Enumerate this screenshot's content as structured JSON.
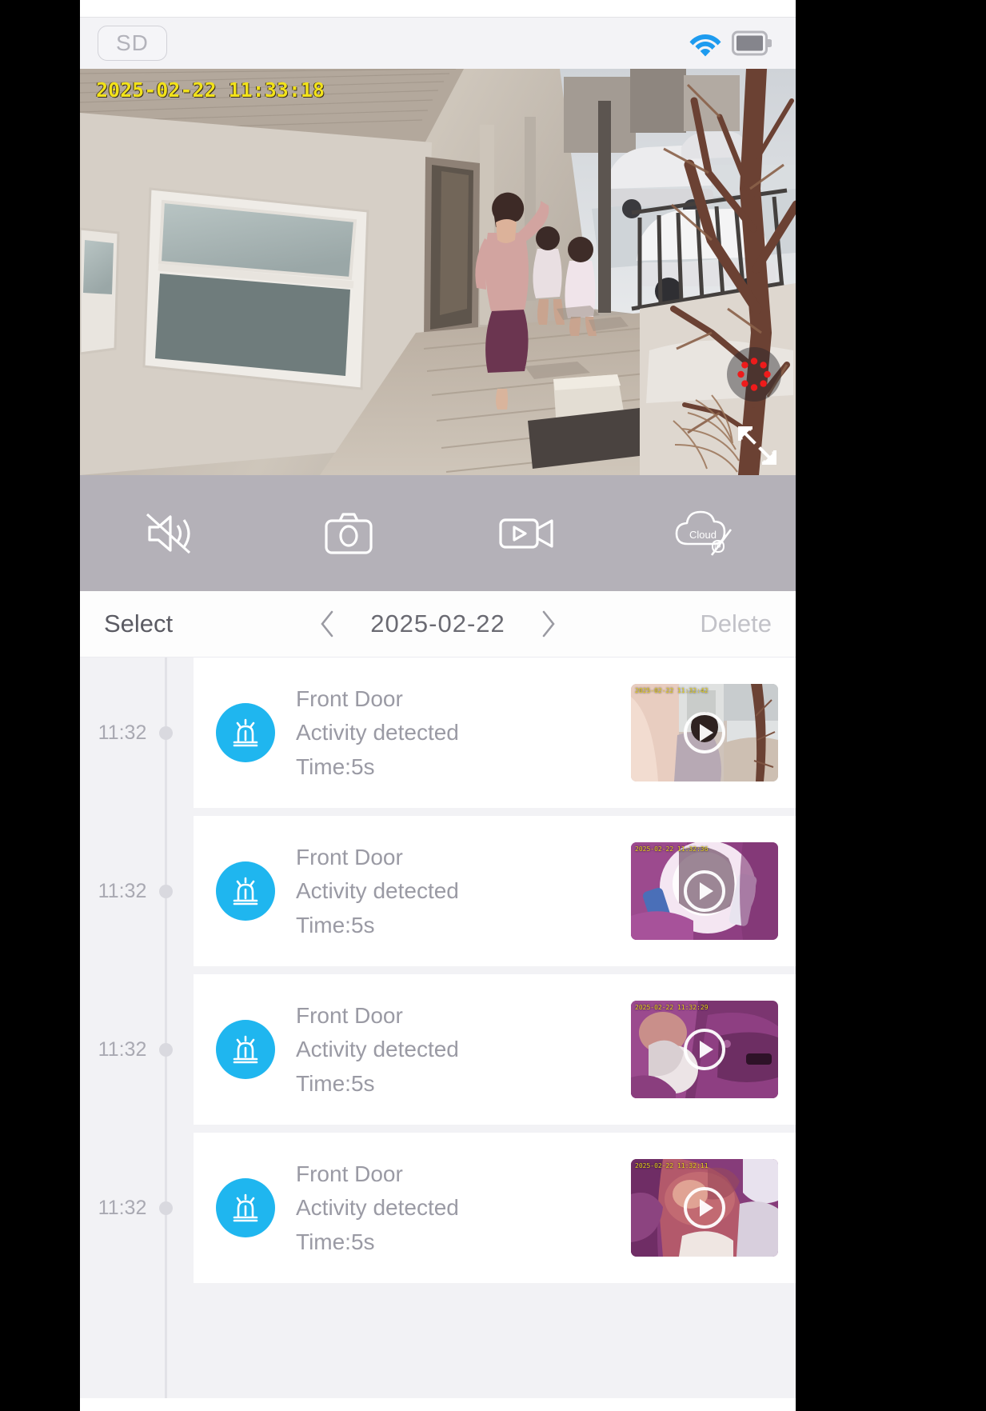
{
  "status_bar": {
    "sd_label": "SD",
    "wifi_icon": "wifi-icon",
    "battery_icon": "battery-icon",
    "wifi_color": "#1d9bef",
    "battery_color": "#8a8a90"
  },
  "video": {
    "timestamp": "2025-02-22 11:33:18",
    "timestamp_color": "#f2e21a",
    "recording_indicator": "loading-spinner-icon",
    "spinner_dot_color": "#ee1b1b",
    "fullscreen_icon": "fullscreen-expand-icon"
  },
  "controls": [
    {
      "name": "mute-button",
      "icon": "speaker-muted-icon",
      "label": "Mute"
    },
    {
      "name": "snapshot-button",
      "icon": "camera-icon",
      "label": "Snapshot"
    },
    {
      "name": "record-button",
      "icon": "video-record-icon",
      "label": "Record"
    },
    {
      "name": "cloud-button",
      "icon": "cloud-disabled-icon",
      "label": "Cloud",
      "badge": "Cloud",
      "sub_badge": "IP"
    }
  ],
  "date_nav": {
    "select_label": "Select",
    "prev_icon": "chevron-left-icon",
    "date": "2025-02-22",
    "next_icon": "chevron-right-icon",
    "delete_label": "Delete",
    "delete_disabled": true
  },
  "events": [
    {
      "time": "11:32",
      "icon": "alarm-siren-icon",
      "title": "Front Door",
      "subtitle": "Activity detected",
      "duration": "Time:5s",
      "thumbnail_timestamp": "2025-02-22 11:32:42",
      "thumbnail_theme": "doorway-person"
    },
    {
      "time": "11:32",
      "icon": "alarm-siren-icon",
      "title": "Front Door",
      "subtitle": "Activity detected",
      "duration": "Time:5s",
      "thumbnail_timestamp": "2025-02-22 11:32:36",
      "thumbnail_theme": "purple-bright"
    },
    {
      "time": "11:32",
      "icon": "alarm-siren-icon",
      "title": "Front Door",
      "subtitle": "Activity detected",
      "duration": "Time:5s",
      "thumbnail_timestamp": "2025-02-22 11:32:29",
      "thumbnail_theme": "purple-dark"
    },
    {
      "time": "11:32",
      "icon": "alarm-siren-icon",
      "title": "Front Door",
      "subtitle": "Activity detected",
      "duration": "Time:5s",
      "thumbnail_timestamp": "2025-02-22 11:32:11",
      "thumbnail_theme": "purple-warm"
    }
  ],
  "colors": {
    "siren_blue": "#1fb6ef",
    "control_bar": "#b4b1b8",
    "list_background": "#f2f2f5",
    "text_muted": "#9a9aa4"
  }
}
